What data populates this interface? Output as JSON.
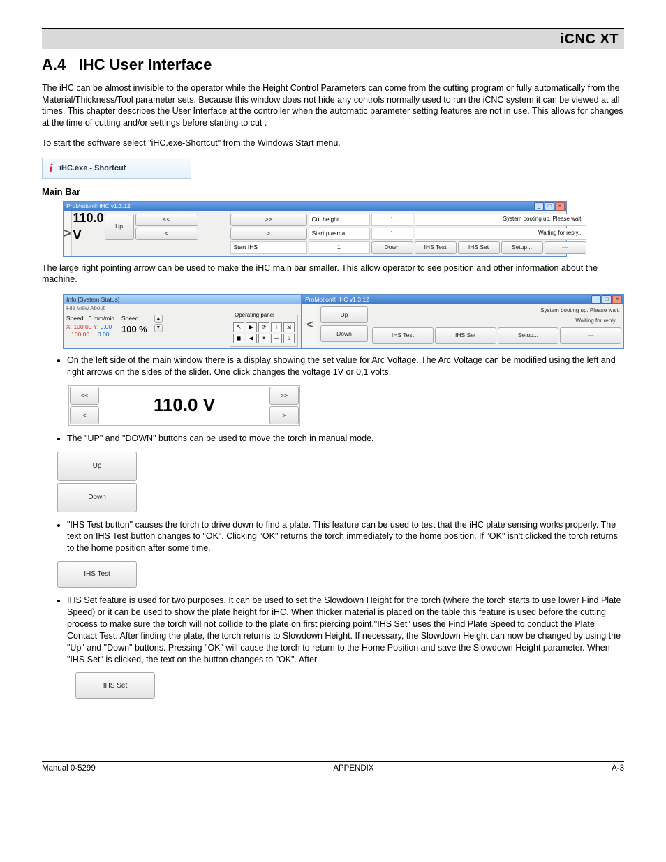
{
  "header": {
    "brand": "iCNC XT"
  },
  "section": {
    "number": "A.4",
    "title": "IHC User Interface"
  },
  "para1": "The iHC can be almost invisible to the operator while the Height Control Parameters can come from the cutting program or fully automatically from the Material/Thickness/Tool parameter sets.  Because this window does not hide any controls normally used to run the iCNC system it can be viewed at all times. This chapter describes the User Interface at the controller when the automatic parameter setting features are not in use. This allows for changes at the time of cutting and/or settings before starting to cut .",
  "para2": "To start the software select \"iHC.exe-Shortcut\" from the Windows Start menu.",
  "shortcut": {
    "label": "iHC.exe - Shortcut"
  },
  "subhead_mainbar": "Main Bar",
  "mainbar": {
    "title": "ProMotion® iHC v1.3.12",
    "arrow_btns": {
      "dleft": "<<",
      "left": "<",
      "dright": ">>",
      "right": ">"
    },
    "voltage": "110.0 V",
    "rows": [
      {
        "label": "Cut height",
        "val": "1"
      },
      {
        "label": "Start plasma",
        "val": "1"
      },
      {
        "label": "Start IHS",
        "val": "1"
      }
    ],
    "side_btns": {
      "up": "Up",
      "down": "Down",
      "ihs_test": "IHS Test",
      "ihs_set": "IHS Set",
      "setup": "Setup..."
    },
    "status1": "System booting up. Please wait.",
    "status2": "Waiting for reply..."
  },
  "para3": "The large right pointing arrow can be used to make the iHC main bar smaller. This allow operator to see position and other information about the machine.",
  "info_window": {
    "title": "Info [System Status]",
    "menus": "File   View   About",
    "speed_label": "Speed",
    "speed_val": "0  mm/min",
    "speed2_label": "Speed",
    "percent": "100 %",
    "x_label": "X:",
    "x1": "100.00",
    "y_label": "Y:",
    "x2": "100.00",
    "y1": "0.00",
    "y2": "0.00",
    "op_panel_label": "Operating panel"
  },
  "right_window": {
    "title": "ProMotion® iHC v1.3.12",
    "status1": "System booting up. Please wait.",
    "status2": "Waiting for reply...",
    "btns": {
      "up": "Up",
      "down": "Down",
      "ihs_test": "IHS Test",
      "ihs_set": "IHS Set",
      "setup": "Setup..."
    }
  },
  "bullets": {
    "b1": "On the left side of the main window there is a display showing the set value for Arc Voltage.  The Arc Voltage can be modified using the left and right arrows on the sides of the slider. One click changes the voltage 1V or 0,1 volts.",
    "b2": "The \"UP\" and \"DOWN\" buttons can be used to move the torch in manual mode.",
    "b3": "\"IHS Test button\" causes the torch to drive down to find a plate. This feature can be used to test that the iHC plate sensing works properly. The text on IHS Test button changes to \"OK\".  Clicking \"OK\" returns the torch immediately to the home position.  If \"OK\" isn't clicked the torch returns to the home position after some time.",
    "b4": "IHS Set feature is used for two purposes. It can be used to set the Slowdown Height for the torch (where the torch starts to use lower Find Plate Speed) or it can be used to show the plate height for iHC. When thicker material is placed on the table this feature is used before the cutting process to make sure the torch will not collide to the plate on first piercing point.\"IHS Set\" uses the Find Plate Speed to conduct the Plate Contact Test.  After finding the plate,  the torch returns to Slowdown Height. If necessary, the Slowdown Height can now be changed by using the \"Up\" and \"Down\" buttons.    Pressing \"OK\" will cause the torch to return to the Home Position and save the Slowdown Height parameter. When \"IHS Set\" is clicked, the text on the button changes to \"OK\".  After"
  },
  "volt_fig": {
    "dleft": "<<",
    "left": "<",
    "dright": ">>",
    "right": ">",
    "value": "110.0 V"
  },
  "updown_fig": {
    "up": "Up",
    "down": "Down"
  },
  "ihs_test_fig": {
    "label": "IHS Test"
  },
  "ihs_set_fig": {
    "label": "IHS Set"
  },
  "footer": {
    "left": "Manual 0-5299",
    "center": "APPENDIX",
    "right": "A-3"
  }
}
